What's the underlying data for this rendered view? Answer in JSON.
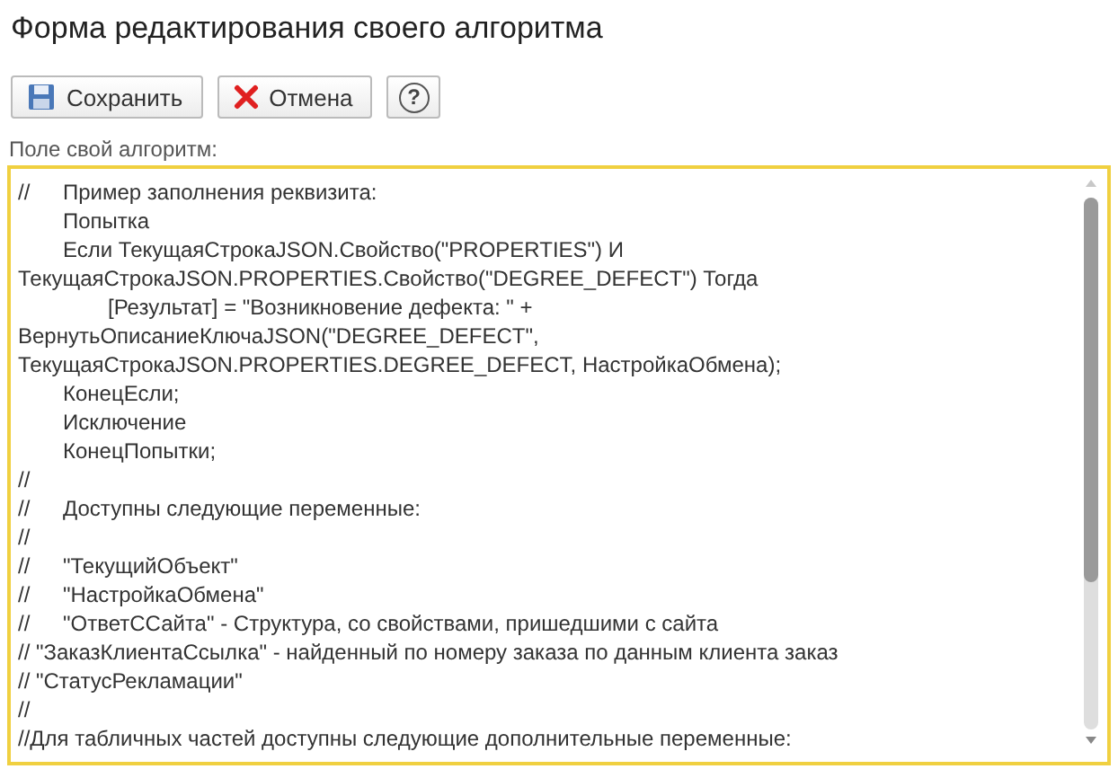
{
  "window": {
    "title": "Форма редактирования своего алгоритма"
  },
  "toolbar": {
    "buttons": [
      {
        "kind": "save",
        "label": "Сохранить"
      },
      {
        "kind": "cancel",
        "label": "Отмена"
      },
      {
        "kind": "help",
        "label": "?"
      }
    ]
  },
  "field": {
    "label": "Поле свой алгоритм:",
    "lines": [
      "//\tПример заполнения реквизита:",
      "\tПопытка",
      "\tЕсли ТекущаяСтрокаJSON.Свойство(\"PROPERTIES\") И",
      "ТекущаяСтрокаJSON.PROPERTIES.Свойство(\"DEGREE_DEFECT\") Тогда",
      "\t\t[Результат] = \"Возникновение дефекта: \" +",
      "ВернутьОписаниеКлючаJSON(\"DEGREE_DEFECT\",",
      "ТекущаяСтрокаJSON.PROPERTIES.DEGREE_DEFECT, НастройкаОбмена);",
      "\tКонецЕсли;",
      "\tИсключение",
      "\tКонецПопытки;",
      "//",
      "//\tДоступны следующие переменные:",
      "//",
      "//\t\"ТекущийОбъект\"",
      "//\t\"НастройкаОбмена\"",
      "//\t\"ОтветССайта\" - Структура, со свойствами, пришедшими с сайта",
      "// \"ЗаказКлиентаСсылка\" - найденный по номеру заказа по данным клиента заказ",
      "// \"СтатусРекламации\"",
      "//",
      "//Для табличных частей доступны следующие дополнительные переменные:"
    ]
  }
}
